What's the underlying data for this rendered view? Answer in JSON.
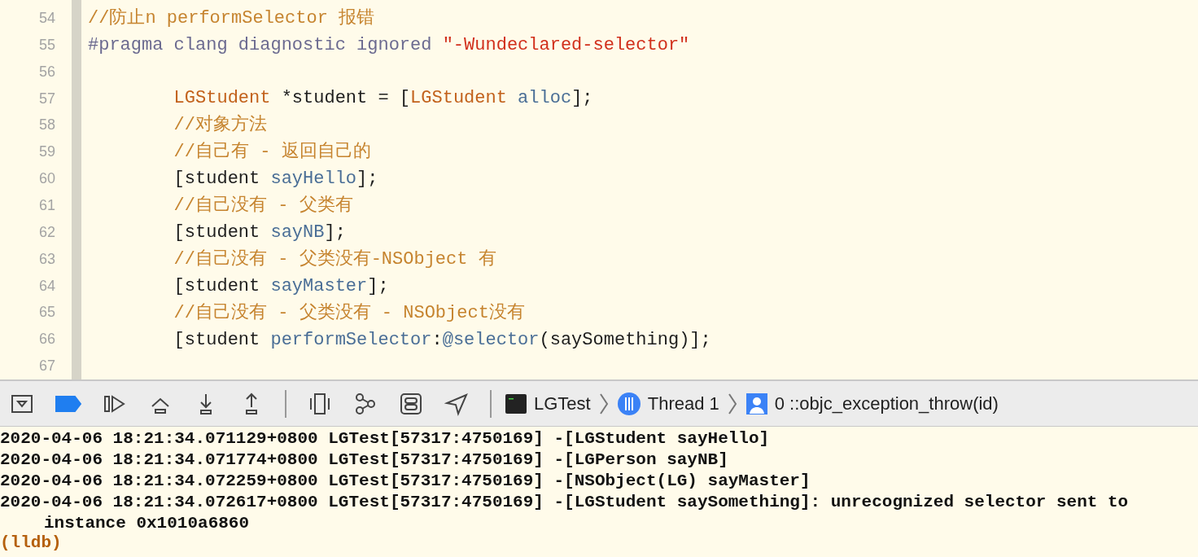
{
  "editor": {
    "lines": [
      {
        "number": "54",
        "tokens": [
          {
            "text": "//防止n performSelector 报错",
            "kind": "comment"
          }
        ]
      },
      {
        "number": "55",
        "tokens": [
          {
            "text": "#pragma clang diagnostic ignored ",
            "kind": "preproc"
          },
          {
            "text": "\"-Wundeclared-selector\"",
            "kind": "string"
          }
        ]
      },
      {
        "number": "56"
      },
      {
        "number": "57",
        "tokens": [
          {
            "text": "        LGStudent",
            "kind": "type"
          },
          {
            "text": " *student = [",
            "kind": "plain"
          },
          {
            "text": "LGStudent",
            "kind": "type"
          },
          {
            "text": " alloc",
            "kind": "method"
          },
          {
            "text": "];",
            "kind": "plain"
          }
        ]
      },
      {
        "number": "58",
        "tokens": [
          {
            "text": "        //对象方法",
            "kind": "comment"
          }
        ]
      },
      {
        "number": "59",
        "tokens": [
          {
            "text": "        //自己有 - 返回自己的",
            "kind": "comment"
          }
        ]
      },
      {
        "number": "60",
        "tokens": [
          {
            "text": "        [student ",
            "kind": "plain"
          },
          {
            "text": "sayHello",
            "kind": "method"
          },
          {
            "text": "];",
            "kind": "plain"
          }
        ]
      },
      {
        "number": "61",
        "tokens": [
          {
            "text": "        //自己没有 - 父类有",
            "kind": "comment"
          }
        ]
      },
      {
        "number": "62",
        "tokens": [
          {
            "text": "        [student ",
            "kind": "plain"
          },
          {
            "text": "sayNB",
            "kind": "method"
          },
          {
            "text": "];",
            "kind": "plain"
          }
        ]
      },
      {
        "number": "63",
        "tokens": [
          {
            "text": "        //自己没有 - 父类没有-NSObject 有",
            "kind": "comment"
          }
        ]
      },
      {
        "number": "64",
        "tokens": [
          {
            "text": "        [student ",
            "kind": "plain"
          },
          {
            "text": "sayMaster",
            "kind": "method"
          },
          {
            "text": "];",
            "kind": "plain"
          }
        ]
      },
      {
        "number": "65",
        "tokens": [
          {
            "text": "        //自己没有 - 父类没有 - NSObject没有",
            "kind": "comment"
          }
        ]
      },
      {
        "number": "66",
        "tokens": [
          {
            "text": "        [student ",
            "kind": "plain"
          },
          {
            "text": "performSelector",
            "kind": "method"
          },
          {
            "text": ":",
            "kind": "plain"
          },
          {
            "text": "@selector",
            "kind": "method"
          },
          {
            "text": "(saySomething)];",
            "kind": "plain"
          }
        ]
      },
      {
        "number": "67"
      }
    ]
  },
  "debug_bar": {
    "breakpoints_active": true,
    "breadcrumbs": [
      {
        "label": "LGTest",
        "kind": "process"
      },
      {
        "label": "Thread 1",
        "kind": "thread"
      },
      {
        "label": "0 ::objc_exception_throw(id)",
        "kind": "frame"
      }
    ]
  },
  "console": {
    "lines": [
      "2020-04-06 18:21:34.071129+0800 LGTest[57317:4750169] -[LGStudent sayHello]",
      "2020-04-06 18:21:34.071774+0800 LGTest[57317:4750169] -[LGPerson sayNB]",
      "2020-04-06 18:21:34.072259+0800 LGTest[57317:4750169] -[NSObject(LG) sayMaster]",
      "2020-04-06 18:21:34.072617+0800 LGTest[57317:4750169] -[LGStudent saySomething]: unrecognized selector sent to instance 0x1010a6860"
    ],
    "prompt": "(lldb)"
  }
}
